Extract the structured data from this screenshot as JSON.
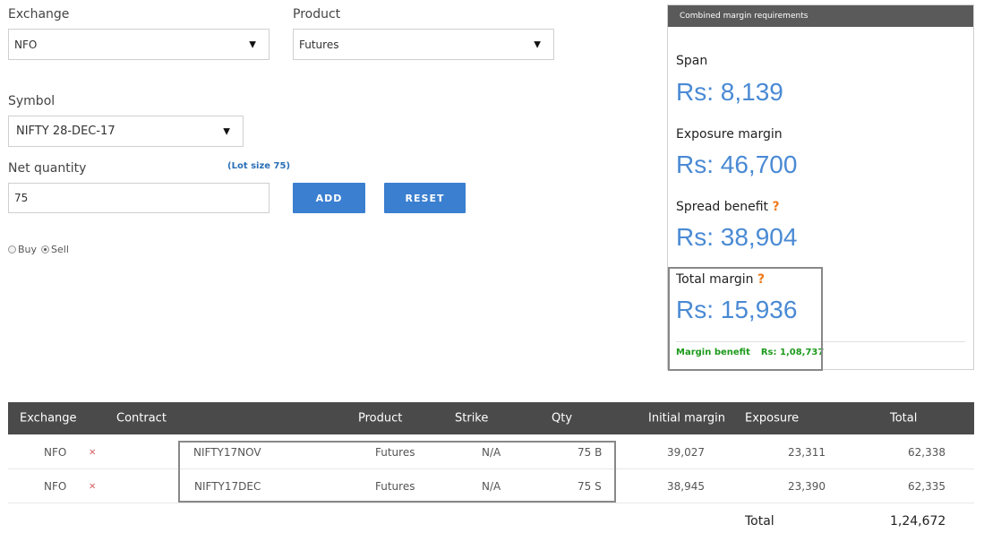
{
  "form": {
    "exchange_label": "Exchange",
    "exchange_value": "NFO",
    "product_label": "Product",
    "product_value": "Futures",
    "symbol_label": "Symbol",
    "symbol_value": "NIFTY 28-DEC-17",
    "qty_label": "Net quantity",
    "lot_size": "(Lot size 75)",
    "qty_value": "75",
    "add_label": "ADD",
    "reset_label": "RESET",
    "buy_label": "Buy",
    "sell_label": "Sell",
    "selected_side": "Sell"
  },
  "margin": {
    "header": "Combined margin requirements",
    "span_label": "Span",
    "span_value": "Rs: 8,139",
    "exposure_label": "Exposure margin",
    "exposure_value": "Rs: 46,700",
    "spread_label": "Spread benefit",
    "spread_value": "Rs: 38,904",
    "total_label": "Total margin",
    "total_value": "Rs: 15,936",
    "help_mark": "?",
    "benefit_label": "Margin benefit",
    "benefit_value": "Rs: 1,08,737"
  },
  "table": {
    "headers": [
      "Exchange",
      "Contract",
      "Product",
      "Strike",
      "Qty",
      "Initial margin",
      "Exposure",
      "Total"
    ],
    "rows": [
      {
        "exchange": "NFO",
        "remove": "×",
        "contract": "NIFTY17NOV",
        "product": "Futures",
        "strike": "N/A",
        "qty": "75 B",
        "initial": "39,027",
        "exposure": "23,311",
        "total": "62,338"
      },
      {
        "exchange": "NFO",
        "remove": "×",
        "contract": "NIFTY17DEC",
        "product": "Futures",
        "strike": "N/A",
        "qty": "75 S",
        "initial": "38,945",
        "exposure": "23,390",
        "total": "62,335"
      }
    ],
    "total_label": "Total",
    "total_value": "1,24,672"
  },
  "colors": {
    "accent": "#3a7fd0",
    "value_blue": "#4a8ad4",
    "benefit_green": "#1c9a1c",
    "help_orange": "#f07a1a"
  }
}
